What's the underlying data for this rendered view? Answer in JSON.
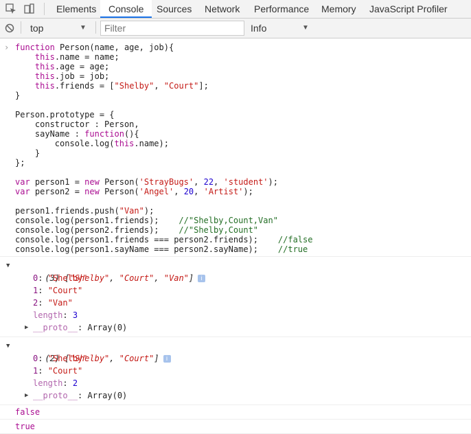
{
  "tabs": [
    {
      "label": "Elements"
    },
    {
      "label": "Console"
    },
    {
      "label": "Sources"
    },
    {
      "label": "Network"
    },
    {
      "label": "Performance"
    },
    {
      "label": "Memory"
    },
    {
      "label": "JavaScript Profiler"
    }
  ],
  "toolbar": {
    "context": "top",
    "filter_placeholder": "Filter",
    "levels": "Info"
  },
  "code": {
    "l1_kw": "function",
    "l1_rest": " Person(name, age, job){",
    "l2_kw": "this",
    "l2_rest": ".name = name;",
    "l3_kw": "this",
    "l3_rest": ".age = age;",
    "l4_kw": "this",
    "l4_rest": ".job = job;",
    "l5_kw": "this",
    "l5_mid": ".friends = [",
    "l5_s1": "\"Shelby\"",
    "l5_comma": ", ",
    "l5_s2": "\"Court\"",
    "l5_end": "];",
    "l6": "}",
    "l8": "Person.prototype = {",
    "l9": "constructor : Person,",
    "l10_a": "sayName : ",
    "l10_kw": "function",
    "l10_b": "(){",
    "l11_a": "console.log(",
    "l11_kw": "this",
    "l11_b": ".name);",
    "l12": "}",
    "l13": "};",
    "l15_kw1": "var",
    "l15_a": " person1 = ",
    "l15_kw2": "new",
    "l15_b": " Person(",
    "l15_s1": "'StrayBugs'",
    "l15_c1": ", ",
    "l15_n": "22",
    "l15_c2": ", ",
    "l15_s2": "'student'",
    "l15_e": ");",
    "l16_kw1": "var",
    "l16_a": " person2 = ",
    "l16_kw2": "new",
    "l16_b": " Person(",
    "l16_s1": "'Angel'",
    "l16_c1": ", ",
    "l16_n": "20",
    "l16_c2": ", ",
    "l16_s2": "'Artist'",
    "l16_e": ");",
    "l18_a": "person1.friends.push(",
    "l18_s": "\"Van\"",
    "l18_e": ");",
    "l19_a": "console.log(person1.friends);    ",
    "l19_c": "//\"Shelby,Count,Van\"",
    "l20_a": "console.log(person2.friends);    ",
    "l20_c": "//\"Shelby,Count\"",
    "l21_a": "console.log(person1.friends === person2.friends);    ",
    "l21_c": "//false",
    "l22_a": "console.log(person1.sayName === person2.sayName);    ",
    "l22_c": "//true"
  },
  "output1": {
    "summary_prefix": "(3) [",
    "s1": "\"Shelby\"",
    "c1": ", ",
    "s2": "\"Court\"",
    "c2": ", ",
    "s3": "\"Van\"",
    "suffix": "]",
    "k0": "0",
    "v0": "\"Shelby\"",
    "k1": "1",
    "v1": "\"Court\"",
    "k2": "2",
    "v2": "\"Van\"",
    "klen": "length",
    "vlen": "3",
    "kproto": "__proto__",
    "vproto": "Array(0)"
  },
  "output2": {
    "summary_prefix": "(2) [",
    "s1": "\"Shelby\"",
    "c1": ", ",
    "s2": "\"Court\"",
    "suffix": "]",
    "k0": "0",
    "v0": "\"Shelby\"",
    "k1": "1",
    "v1": "\"Court\"",
    "klen": "length",
    "vlen": "2",
    "kproto": "__proto__",
    "vproto": "Array(0)"
  },
  "output3": "false",
  "output4": "true",
  "info_badge": "i"
}
